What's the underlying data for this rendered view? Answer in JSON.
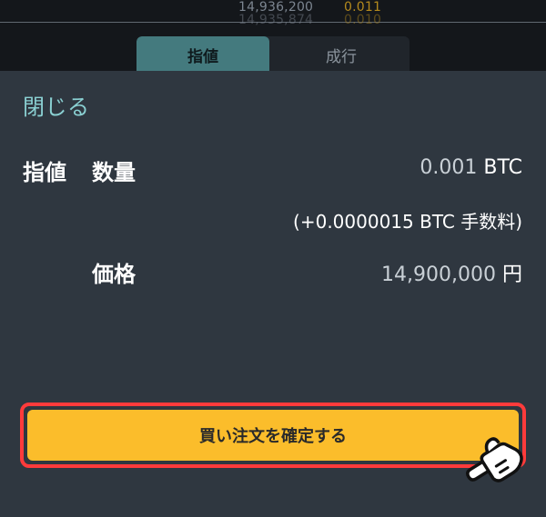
{
  "background": {
    "prices": [
      "14,936,200",
      "14,935,874"
    ],
    "amounts": [
      "0.011",
      "0.010"
    ],
    "tabs": {
      "active": "指値",
      "inactive": "成行"
    }
  },
  "sheet": {
    "close_label": "閉じる",
    "order_type": "指値",
    "quantity": {
      "label": "数量",
      "value": "0.001",
      "unit": "BTC"
    },
    "fee_note": "(+0.0000015 BTC 手数料)",
    "price": {
      "label": "価格",
      "value": "14,900,000",
      "unit": "円"
    },
    "confirm_label": "買い注文を確定する"
  },
  "icons": {
    "hand": "pointing-hand-icon"
  },
  "colors": {
    "sheet_bg": "#2f3740",
    "accent_teal": "#8ad0d2",
    "confirm_yellow": "#fbbd2b",
    "highlight_red": "#ff3b3b"
  }
}
